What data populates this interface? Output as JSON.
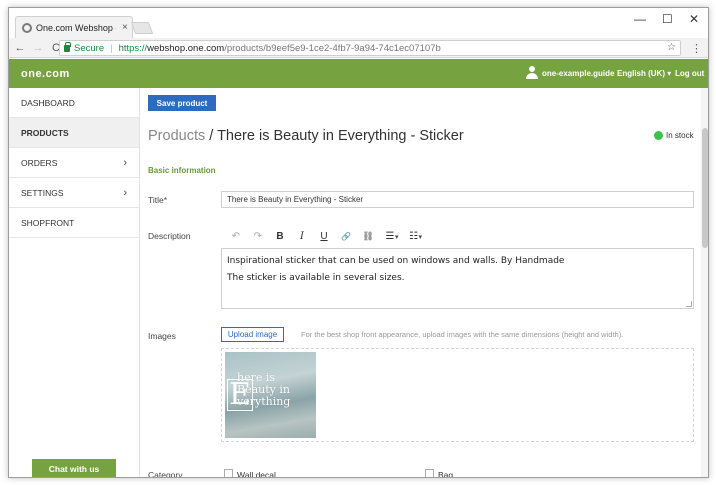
{
  "browser": {
    "tab_title": "One.com Webshop - Up",
    "tab_close": "×",
    "window_controls": {
      "minimize": "—",
      "maximize": "☐",
      "close": "✕"
    },
    "nav": {
      "back": "←",
      "forward": "→",
      "reload": "C"
    },
    "secure_label": "Secure",
    "url_sep": "|",
    "url_scheme": "https://",
    "url_host": "webshop.one.com",
    "url_path": "/products/b9eef5e9-1ce2-4fb7-9a94-74c1ec07107b",
    "star": "☆",
    "menu": "⋮"
  },
  "header": {
    "logo": "one.com",
    "user": "one-example.guide",
    "language": "English (UK) ▾",
    "logout": "Log out"
  },
  "sidebar": {
    "items": [
      {
        "label": "DASHBOARD",
        "chevron": ""
      },
      {
        "label": "PRODUCTS",
        "chevron": ""
      },
      {
        "label": "ORDERS",
        "chevron": "›"
      },
      {
        "label": "SETTINGS",
        "chevron": "›"
      },
      {
        "label": "SHOPFRONT",
        "chevron": ""
      }
    ],
    "chat_label": "Chat with us"
  },
  "main": {
    "save_label": "Save product",
    "breadcrumb_root": "Products",
    "breadcrumb_sep": " / ",
    "title": "There is Beauty in Everything - Sticker",
    "stock_status": "In stock",
    "section_title": "Basic information",
    "title_label": "Title*",
    "title_value": "There is Beauty in Everything - Sticker",
    "description_label": "Description",
    "toolbar": {
      "undo": "↶",
      "redo": "↷",
      "bold": "B",
      "italic": "I",
      "underline": "U",
      "link": "🔗",
      "unlink": "⛓",
      "ordered_list": "☰",
      "unordered_list": "☷",
      "caret": "▾"
    },
    "description_lines": [
      "Inspirational sticker that can be used on windows and walls. By Handmade",
      "The sticker is available in several sizes."
    ],
    "images_label": "Images",
    "upload_label": "Upload image",
    "upload_hint": "For the best shop front appearance, upload images with the same dimensions (height and width).",
    "image_text": [
      "here is",
      "Beauty in",
      "verything"
    ],
    "image_big_letter": "E",
    "category_label": "Category",
    "categories": [
      "Wall decal",
      "Bag"
    ]
  }
}
